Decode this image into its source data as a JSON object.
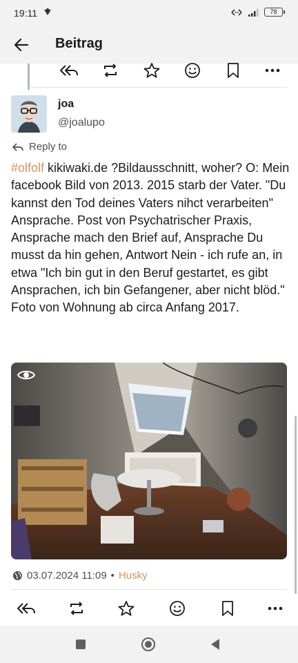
{
  "status_bar": {
    "time": "19:11",
    "battery": "78"
  },
  "app_bar": {
    "title": "Beitrag"
  },
  "post": {
    "display_name": "joa",
    "handle": "@joalupo",
    "reply_to_label": "Reply to",
    "hashtag": "#olfolf",
    "text": " kikiwaki.de ?Bildausschnitt, woher? O: Mein facebook Bild von 2013. 2015 starb der Vater. \"Du kannst den Tod deines Vaters nihct verarbeiten\" Ansprache. Post von Psychatrischer Praxis, Ansprache mach den Brief auf, Ansprache Du musst da hin gehen, Antwort Nein - ich rufe an, in etwa \"Ich bin gut in den Beruf gestartet, es gibt Ansprachen, ich bin Gefangener, aber nicht blöd.\" Foto von Wohnung ab circa Anfang 2017.",
    "timestamp": "03.07.2024 11:09",
    "separator": "•",
    "app_name": "Husky"
  },
  "actions": [
    "reply-all-icon",
    "boost-icon",
    "favourite-icon",
    "emoji-react-icon",
    "bookmark-icon",
    "more-icon"
  ],
  "icons": {
    "visibility": "public-globe-icon",
    "media_toggle": "eye-icon"
  },
  "colors": {
    "accent": "#d6935b",
    "bar_bg": "#f2f2f2",
    "text": "#1c1c1c",
    "muted": "#505050"
  }
}
